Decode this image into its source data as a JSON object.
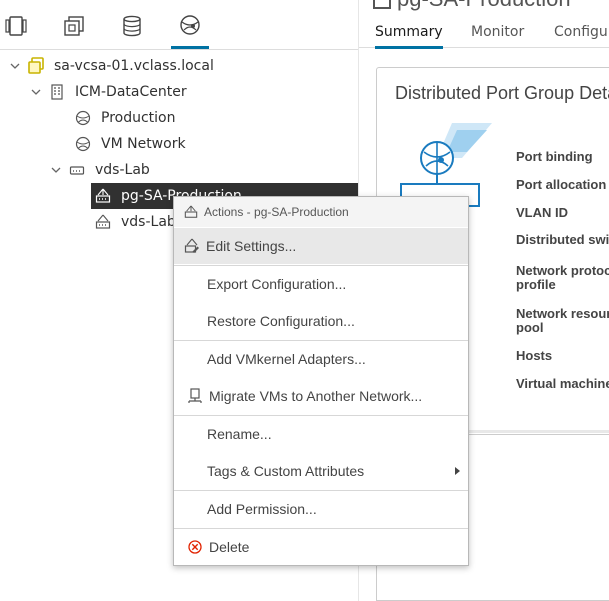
{
  "navigator": {
    "tabs": [
      {
        "icon": "hosts-clusters-icon"
      },
      {
        "icon": "vms-templates-icon"
      },
      {
        "icon": "storage-icon"
      },
      {
        "icon": "networking-icon",
        "active": true
      }
    ],
    "tree": [
      {
        "label": "sa-vcsa-01.vclass.local",
        "icon": "vcenter-icon"
      },
      {
        "label": "ICM-DataCenter",
        "icon": "datacenter-icon"
      },
      {
        "label": "Production",
        "icon": "network-icon"
      },
      {
        "label": "VM Network",
        "icon": "network-icon"
      },
      {
        "label": "vds-Lab",
        "icon": "distributed-switch-icon"
      },
      {
        "label": "pg-SA-Production",
        "icon": "port-group-icon",
        "selected": true
      },
      {
        "label": "vds-Lab",
        "icon": "uplink-port-group-icon"
      }
    ]
  },
  "content": {
    "object_title": "pg-SA-Production",
    "tabs": [
      "Summary",
      "Monitor",
      "Configure"
    ],
    "active_tab": "Summary",
    "card_title": "Distributed Port Group Details",
    "properties": [
      "Port binding",
      "Port allocation",
      "VLAN ID",
      "Distributed switch",
      "Network protocol\nprofile",
      "Network resource\npool",
      "Hosts",
      "Virtual machines"
    ]
  },
  "context_menu": {
    "header": "Actions - pg-SA-Production",
    "items": [
      {
        "label": "Edit Settings...",
        "icon": "edit-settings-icon"
      },
      {
        "label": "Export Configuration..."
      },
      {
        "label": "Restore Configuration..."
      },
      {
        "label": "Add VMkernel Adapters..."
      },
      {
        "label": "Migrate VMs to Another Network...",
        "icon": "migrate-icon"
      },
      {
        "label": "Rename..."
      },
      {
        "label": "Tags & Custom Attributes",
        "submenu": true
      },
      {
        "label": "Add Permission..."
      },
      {
        "label": "Delete",
        "icon": "delete-icon"
      }
    ]
  },
  "colors": {
    "accent": "#0072a3",
    "selected_row": "#313131",
    "delete_icon": "#e12200",
    "folder_icon": "#c8b400"
  }
}
